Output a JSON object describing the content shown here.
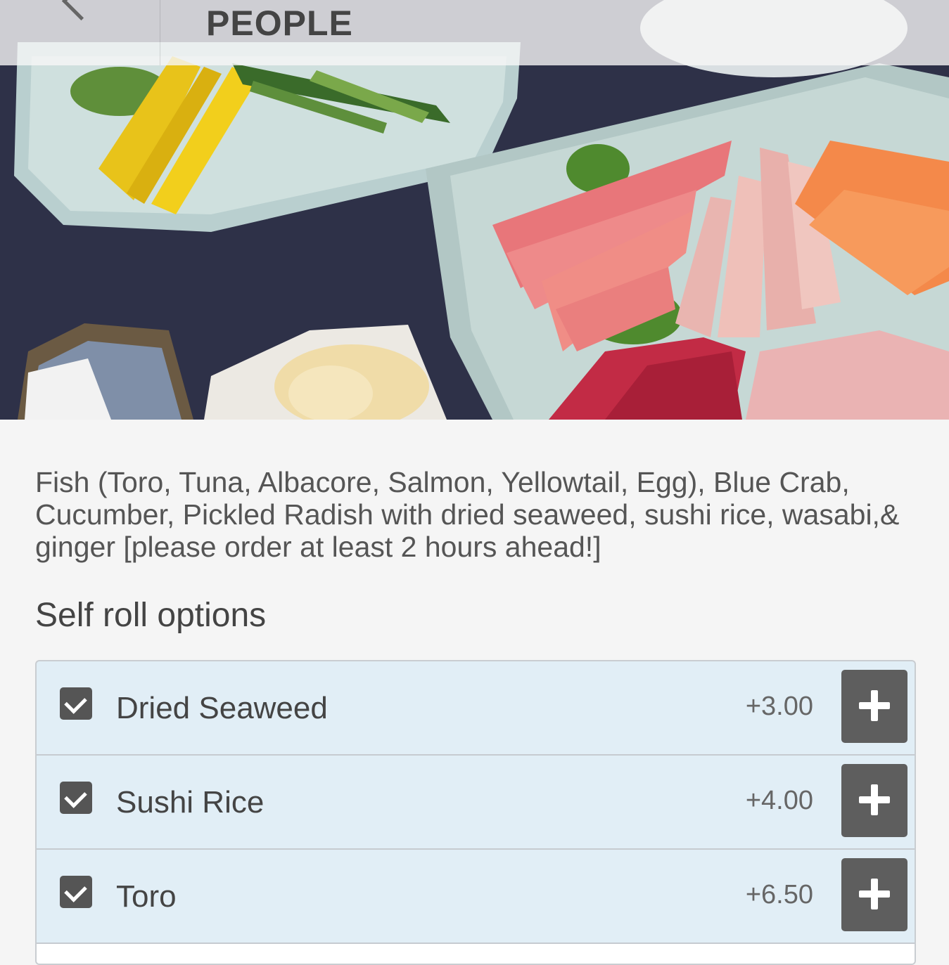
{
  "header": {
    "title": "PEOPLE",
    "back_icon": "chevron-left-icon"
  },
  "hero": {
    "image_subject": "sushi hand roll platter with sashimi, pickled radish, cucumber, ginger and wasabi"
  },
  "item": {
    "description": "Fish (Toro, Tuna, Albacore, Salmon, Yellowtail, Egg), Blue Crab, Cucumber, Pickled Radish with dried seaweed, sushi rice, wasabi,& ginger [please order at least 2 hours ahead!]"
  },
  "options_section": {
    "title": "Self roll options",
    "items": [
      {
        "label": "Dried Seaweed",
        "price": "+3.00",
        "checked": true
      },
      {
        "label": "Sushi Rice",
        "price": "+4.00",
        "checked": true
      },
      {
        "label": "Toro",
        "price": "+6.50",
        "checked": true
      }
    ]
  },
  "colors": {
    "option_bg": "#e1eef6",
    "button_bg": "#5e5e5e",
    "page_bg": "#f5f5f5"
  }
}
